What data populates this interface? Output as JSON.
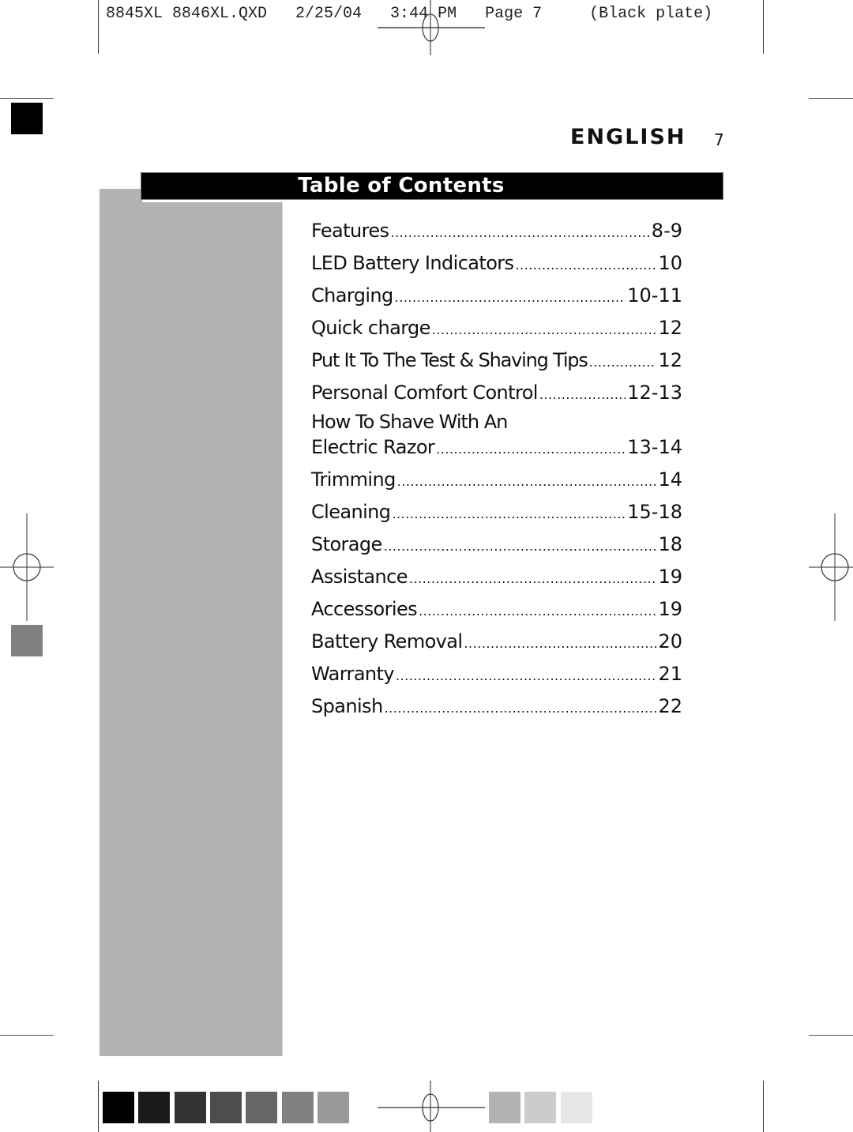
{
  "slug": {
    "text": "8845XL 8846XL.QXD   2/25/04   3:44 PM   Page 7     (Black plate)"
  },
  "header": {
    "language": "ENGLISH",
    "page_number": "7"
  },
  "toc": {
    "title": "Table of Contents",
    "items": [
      {
        "label": "Features",
        "page": "8-9"
      },
      {
        "label": "LED Battery Indicators",
        "page": "10"
      },
      {
        "label": "Charging",
        "page": "10-11"
      },
      {
        "label": "Quick charge",
        "page": "12"
      },
      {
        "label": "Put It To The Test & Shaving Tips",
        "page": "12"
      },
      {
        "label": "Personal Comfort Control",
        "page": "12-13"
      },
      {
        "label_line1": "How To Shave With An",
        "label": "Electric Razor",
        "page": "13-14"
      },
      {
        "label": "Trimming",
        "page": "14"
      },
      {
        "label": "Cleaning",
        "page": "15-18"
      },
      {
        "label": "Storage",
        "page": "18"
      },
      {
        "label": "Assistance",
        "page": "19"
      },
      {
        "label": "Accessories",
        "page": "19"
      },
      {
        "label": "Battery Removal",
        "page": "20"
      },
      {
        "label": "Warranty",
        "page": "21"
      },
      {
        "label": "Spanish",
        "page": "22"
      }
    ]
  },
  "color_bar": {
    "left_swatches": [
      "#000000",
      "#1a1a1a",
      "#333333",
      "#4d4d4d",
      "#666666",
      "#808080",
      "#999999"
    ],
    "right_swatches": [
      "#b3b3b3",
      "#cccccc",
      "#e6e6e6"
    ]
  },
  "colors": {
    "panel_gray": "#b3b3b3",
    "corner_black": "#000000",
    "corner_gray": "#808080"
  }
}
